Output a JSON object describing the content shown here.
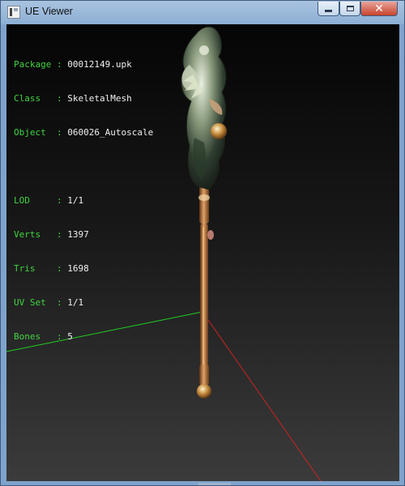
{
  "window": {
    "title": "UE Viewer",
    "icon": "ue-viewer-app-icon"
  },
  "controls": {
    "minimize_icon": "minimize-icon",
    "maximize_icon": "maximize-icon",
    "close_icon": "close-icon",
    "close_glyph": "✕"
  },
  "info_lines": [
    {
      "key": "Package",
      "sep": " : ",
      "value": "00012149.upk"
    },
    {
      "key": "Class  ",
      "sep": " : ",
      "value": "SkeletalMesh"
    },
    {
      "key": "Object ",
      "sep": " : ",
      "value": "060026_Autoscale"
    }
  ],
  "stats_lines": [
    {
      "key": "LOD    ",
      "sep": " : ",
      "value": "1/1"
    },
    {
      "key": "Verts  ",
      "sep": " : ",
      "value": "1397"
    },
    {
      "key": "Tris   ",
      "sep": " : ",
      "value": "1698"
    },
    {
      "key": "UV Set ",
      "sep": " : ",
      "value": "1/1"
    },
    {
      "key": "Bones  ",
      "sep": " : ",
      "value": "5"
    }
  ],
  "colors": {
    "label_green": "#3fd43f",
    "value_white": "#f0f0f0",
    "axis_x": "#22cc22",
    "axis_y": "#cc2222"
  }
}
